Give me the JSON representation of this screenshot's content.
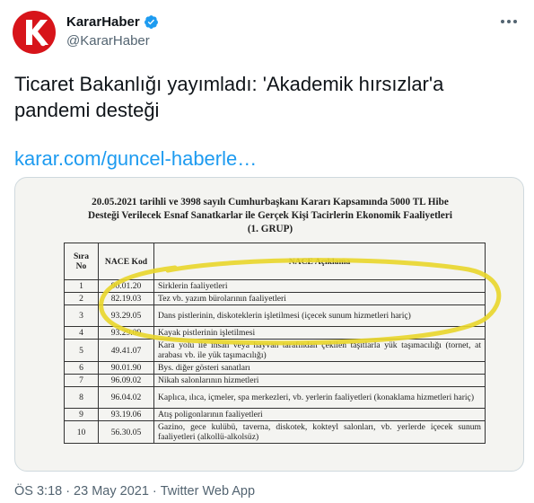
{
  "author": {
    "display_name": "KararHaber",
    "handle": "@KararHaber",
    "verified": true,
    "avatar_letter": "K"
  },
  "tweet": {
    "text": "Ticaret Bakanlığı yayımladı: 'Akademik hırsızlar'a pandemi desteği",
    "link": "karar.com/guncel-haberle…"
  },
  "document": {
    "title_lines": [
      "20.05.2021 tarihli ve 3998 sayılı Cumhurbaşkanı Kararı Kapsamında 5000 TL Hibe",
      "Desteği Verilecek Esnaf Sanatkarlar ile Gerçek Kişi Tacirlerin Ekonomik Faaliyetleri",
      "(1. GRUP)"
    ],
    "headers": {
      "sira": "Sıra No",
      "kod": "NACE Kod",
      "aciklama": "NACE Açıklama"
    },
    "rows": [
      {
        "sira": "1",
        "kod": "90.01.20",
        "aciklama": "Sirklerin faaliyetleri"
      },
      {
        "sira": "2",
        "kod": "82.19.03",
        "aciklama": "Tez vb. yazım bürolarının faaliyetleri"
      },
      {
        "sira": "3",
        "kod": "93.29.05",
        "aciklama": "Dans pistlerinin, diskoteklerin işletilmesi (içecek sunum hizmetleri hariç)"
      },
      {
        "sira": "4",
        "kod": "93.29.09",
        "aciklama": "Kayak pistlerinin işletilmesi"
      },
      {
        "sira": "5",
        "kod": "49.41.07",
        "aciklama": "Kara yolu ile insan veya hayvan tarafından çekilen taşıtlarla yük taşımacılığı (tornet, at arabası vb. ile yük taşımacılığı)"
      },
      {
        "sira": "6",
        "kod": "90.01.90",
        "aciklama": "Bys. diğer gösteri sanatları"
      },
      {
        "sira": "7",
        "kod": "96.09.02",
        "aciklama": "Nikah salonlarının hizmetleri"
      },
      {
        "sira": "8",
        "kod": "96.04.02",
        "aciklama": "Kaplıca, ılıca, içmeler, spa merkezleri, vb. yerlerin faaliyetleri (konaklama hizmetleri hariç)"
      },
      {
        "sira": "9",
        "kod": "93.19.06",
        "aciklama": "Atış poligonlarının faaliyetleri"
      },
      {
        "sira": "10",
        "kod": "56.30.05",
        "aciklama": "Gazino, gece kulübü, taverna, diskotek, kokteyl salonları, vb. yerlerde içecek sunum faaliyetleri (alkollü-alkolsüz)"
      }
    ],
    "highlight_color": "#e9d62a"
  },
  "meta": {
    "time": "ÖS 3:18",
    "date": "23 May 2021",
    "separator": "·",
    "source": "Twitter Web App"
  },
  "colors": {
    "brand_red": "#d7141a",
    "link_blue": "#1d9bf0",
    "verified_blue": "#1d9bf0",
    "muted": "#536471"
  },
  "icons": {
    "verified": "verified-badge-icon",
    "more": "more-horizontal-icon"
  }
}
